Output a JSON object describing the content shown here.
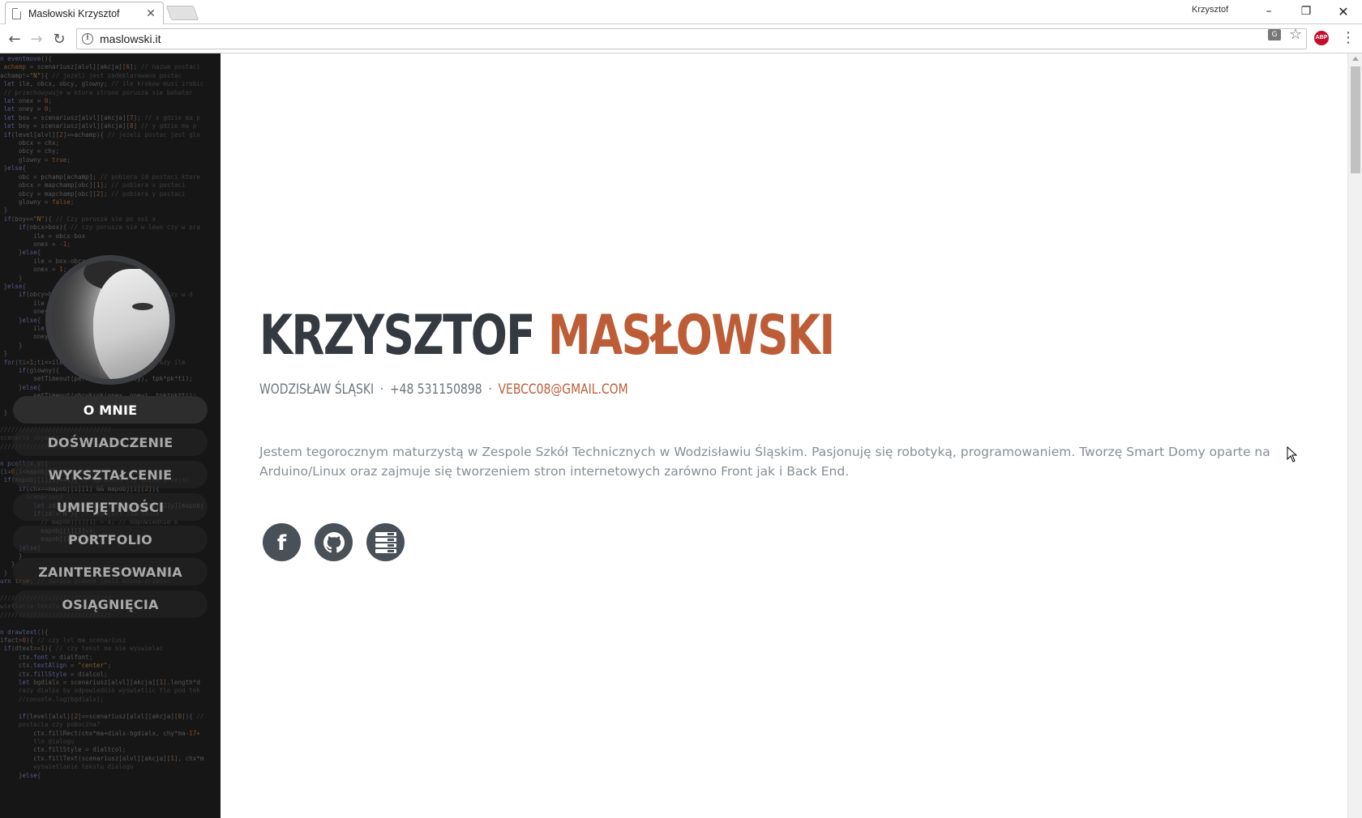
{
  "browser": {
    "tab_title": "Masłowski Krzysztof",
    "tab_close": "✕",
    "profile_name": "Krzysztof",
    "url": "maslowski.it",
    "window_controls": {
      "minimize": "–",
      "maximize": "❐",
      "close": "✕"
    },
    "nav": {
      "back": "←",
      "forward": "→",
      "reload": "↻"
    },
    "abp_label": "ABP",
    "menu_glyph": "⋮",
    "star_glyph": "☆"
  },
  "sidebar": {
    "nav_items": [
      {
        "label": "O MNIE",
        "active": true
      },
      {
        "label": "DOŚWIADCZENIE",
        "active": false
      },
      {
        "label": "WYKSZTAŁCENIE",
        "active": false
      },
      {
        "label": "UMIEJĘTNOŚCI",
        "active": false
      },
      {
        "label": "PORTFOLIO",
        "active": false
      },
      {
        "label": "ZAINTERESOWANIA",
        "active": false
      },
      {
        "label": "OSIĄGNIĘCIA",
        "active": false
      }
    ]
  },
  "profile": {
    "first_name": "KRZYSZTOF",
    "last_name": "MASŁOWSKI",
    "city": "WODZISŁAW ŚLĄSKI",
    "separator": "·",
    "phone": "+48 531150898",
    "email": "VEBCC08@GMAIL.COM",
    "bio": "Jestem tegorocznym maturzystą w Zespole Szkół Technicznych w Wodzisławiu Śląskim. Pasjonuję się robotyką, programowaniem. Tworzę Smart Domy oparte na Arduino/Linux oraz zajmuje się tworzeniem stron internetowych zarówno Front jak i Back End."
  },
  "social": {
    "facebook_glyph": "f",
    "icons": [
      "facebook-icon",
      "github-icon",
      "server-icon"
    ]
  },
  "colors": {
    "accent": "#bd5d38",
    "heading": "#343a40",
    "muted": "#868e96",
    "sidebar_bg": "#161616",
    "social_bg": "#495057"
  }
}
